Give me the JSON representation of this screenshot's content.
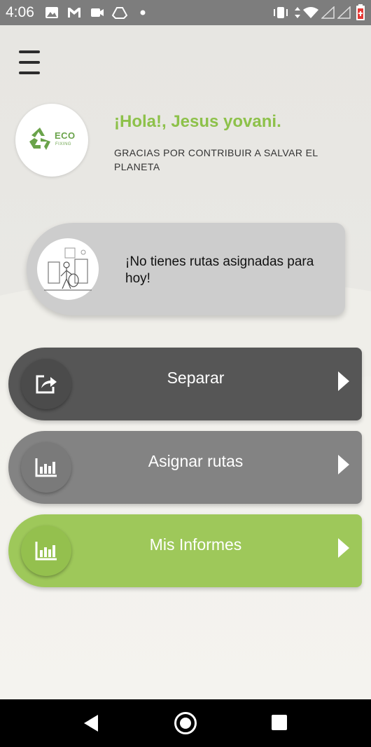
{
  "status_bar": {
    "time": "4:06",
    "icons": [
      "image-icon",
      "gmail-icon",
      "video-icon",
      "drive-icon",
      "dot-icon",
      "vibrate-icon",
      "data-arrows-icon",
      "wifi-icon",
      "signal-icon",
      "signal-icon",
      "battery-icon"
    ]
  },
  "header": {
    "menu_icon": "hamburger-menu-icon",
    "logo": {
      "line1": "ECO",
      "line2": "FIXING"
    },
    "greeting": "¡Hola!, Jesus yovani.",
    "subtitle": "GRACIAS POR CONTRIBUIR A SALVAR EL PLANETA"
  },
  "route_card": {
    "message": "¡No tienes rutas asignadas para hoy!"
  },
  "actions": [
    {
      "label": "Separar",
      "icon": "share-icon",
      "color": "#565656"
    },
    {
      "label": "Asignar rutas",
      "icon": "bar-chart-icon",
      "color": "#838383"
    },
    {
      "label": "Mis Informes",
      "icon": "bar-chart-icon",
      "color": "#9ec85a"
    }
  ],
  "colors": {
    "accent_green": "#8dc14a"
  },
  "nav_bar": {
    "icons": [
      "back-icon",
      "home-icon",
      "recents-icon"
    ]
  }
}
